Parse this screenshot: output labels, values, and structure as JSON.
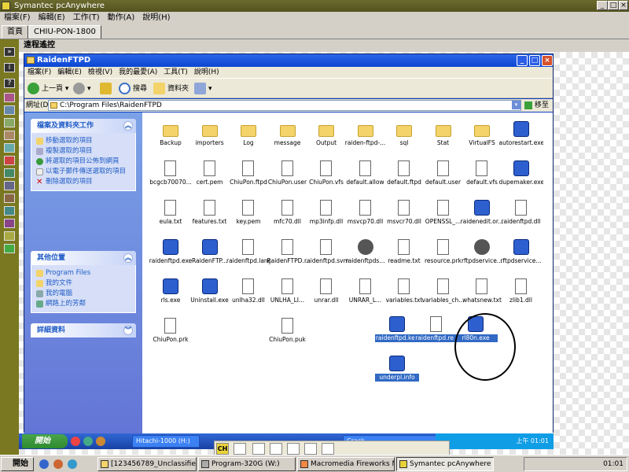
{
  "app": {
    "title": "Symantec pcAnywhere"
  },
  "menu": [
    "檔案(F)",
    "編輯(E)",
    "工作(T)",
    "動作(A)",
    "說明(H)"
  ],
  "tabs": [
    "首頁",
    "CHIU-PON-1800"
  ],
  "remote_bar": "遠程遙控",
  "explorer": {
    "title": "RaidenFTPD",
    "menu": [
      "檔案(F)",
      "編輯(E)",
      "檢視(V)",
      "我的最愛(A)",
      "工具(T)",
      "說明(H)"
    ],
    "toolbar": {
      "back": "上一頁",
      "search": "搜尋",
      "folders": "資料夾"
    },
    "address_label": "網址(D)",
    "address": "C:\\Program Files\\RaidenFTPD",
    "go": "移至"
  },
  "pane": {
    "tasks_title": "檔案及資料夾工作",
    "tasks": [
      "移動選取的項目",
      "複製選取的項目",
      "將選取的項目公佈到網頁",
      "以電子郵件傳送選取的項目",
      "刪除選取的項目"
    ],
    "places_title": "其他位置",
    "places": [
      "Program Files",
      "我的文件",
      "我的電腦",
      "網路上的芳鄰"
    ],
    "details_title": "詳細資料"
  },
  "files": [
    {
      "name": "Backup",
      "type": "folder"
    },
    {
      "name": "importers",
      "type": "folder"
    },
    {
      "name": "Log",
      "type": "folder"
    },
    {
      "name": "message",
      "type": "folder"
    },
    {
      "name": "Output",
      "type": "folder"
    },
    {
      "name": "raiden-ftpd-...",
      "type": "folder"
    },
    {
      "name": "sql",
      "type": "folder"
    },
    {
      "name": "Stat",
      "type": "folder"
    },
    {
      "name": "VirtualFS",
      "type": "folder"
    },
    {
      "name": "autorestart.exe",
      "type": "exe"
    },
    {
      "name": "bcgcb70070...",
      "type": "dll"
    },
    {
      "name": "cert.pem",
      "type": "doc"
    },
    {
      "name": "ChiuPon.ftpd",
      "type": "doc"
    },
    {
      "name": "ChiuPon.user",
      "type": "doc"
    },
    {
      "name": "ChiuPon.vfs",
      "type": "doc"
    },
    {
      "name": "default.allow",
      "type": "doc"
    },
    {
      "name": "default.ftpd",
      "type": "doc"
    },
    {
      "name": "default.user",
      "type": "doc"
    },
    {
      "name": "default.vfs",
      "type": "doc"
    },
    {
      "name": "dupemaker.exe",
      "type": "exe"
    },
    {
      "name": "eula.txt",
      "type": "doc"
    },
    {
      "name": "features.txt",
      "type": "doc"
    },
    {
      "name": "key.pem",
      "type": "doc"
    },
    {
      "name": "mfc70.dll",
      "type": "dll"
    },
    {
      "name": "mp3infp.dll",
      "type": "dll"
    },
    {
      "name": "msvcp70.dll",
      "type": "dll"
    },
    {
      "name": "msvcr70.dll",
      "type": "dll"
    },
    {
      "name": "OPENSSL_...",
      "type": "doc"
    },
    {
      "name": "raidenedit.or...",
      "type": "exe"
    },
    {
      "name": "raidenftpd.dll",
      "type": "dll"
    },
    {
      "name": "raidenftpd.exe",
      "type": "exe"
    },
    {
      "name": "RaidenFTP...",
      "type": "exe"
    },
    {
      "name": "raidenftpd.lang",
      "type": "doc"
    },
    {
      "name": "RaidenFTPD...",
      "type": "doc"
    },
    {
      "name": "raidenftpd.svm",
      "type": "doc"
    },
    {
      "name": "raidenftpds...",
      "type": "gear"
    },
    {
      "name": "readme.txt",
      "type": "doc"
    },
    {
      "name": "resource.prk",
      "type": "doc"
    },
    {
      "name": "rftpdservice...",
      "type": "gear"
    },
    {
      "name": "rftpdservice...",
      "type": "exe"
    },
    {
      "name": "rls.exe",
      "type": "exe"
    },
    {
      "name": "Uninstall.exe",
      "type": "exe"
    },
    {
      "name": "unlha32.dll",
      "type": "dll"
    },
    {
      "name": "UNLHA_LI...",
      "type": "doc"
    },
    {
      "name": "unrar.dll",
      "type": "dll"
    },
    {
      "name": "UNRAR_L...",
      "type": "doc"
    },
    {
      "name": "variables.txt",
      "type": "doc"
    },
    {
      "name": "variables_ch...",
      "type": "doc"
    },
    {
      "name": "whatsnew.txt",
      "type": "doc"
    },
    {
      "name": "zlib1.dll",
      "type": "dll"
    },
    {
      "name": "ChiuPon.prk",
      "type": "doc"
    },
    {
      "name": "ChiuPon.puk",
      "type": "doc"
    }
  ],
  "selected_files": [
    {
      "name": "raidenftpd.key",
      "type": "exe"
    },
    {
      "name": "raidenftpd.reg",
      "type": "doc"
    },
    {
      "name": "rl80n.exe",
      "type": "exe"
    },
    {
      "name": "underpl.info",
      "type": "exe"
    }
  ],
  "remote_taskbar": {
    "start": "開始",
    "buttons": [
      "Hitachi-1000 (H:)",
      "Crack"
    ],
    "lang": "CH",
    "clock": "上午 01:01"
  },
  "host_taskbar": {
    "start": "開始",
    "buttons": [
      "[123456789_Unclassified...",
      "Program-320G (W:)",
      "Macromedia Fireworks M...",
      "Symantec pcAnywhere"
    ],
    "clock": "01:01"
  }
}
